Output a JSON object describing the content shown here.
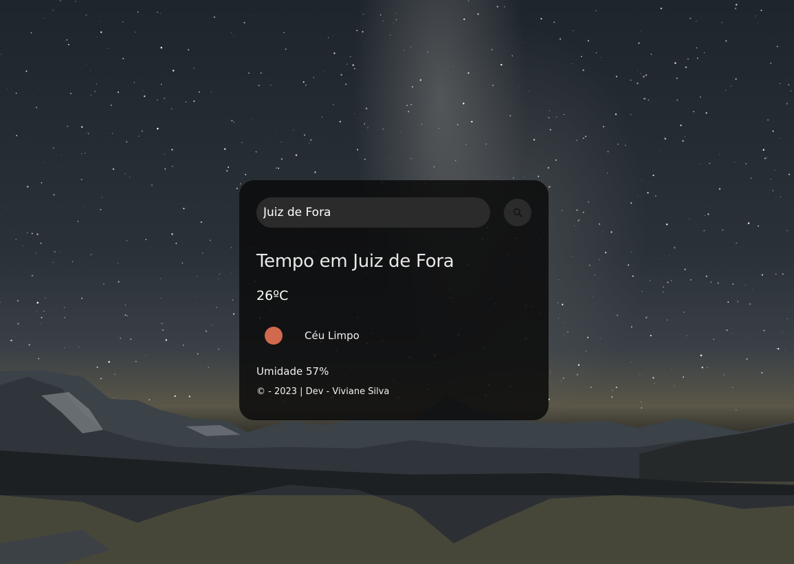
{
  "search": {
    "value": "Juiz de Fora",
    "button_icon": "search-icon"
  },
  "weather": {
    "title": "Tempo em Juiz de Fora",
    "temperature": "26ºC",
    "icon": "sun-icon",
    "icon_color": "#d0694e",
    "description": "Céu Limpo",
    "humidity": "Umidade 57%"
  },
  "footer": {
    "text": "© - 2023 | Dev - Viviane Silva"
  },
  "background": {
    "icon": "starry-night-mountain-lake-image"
  }
}
